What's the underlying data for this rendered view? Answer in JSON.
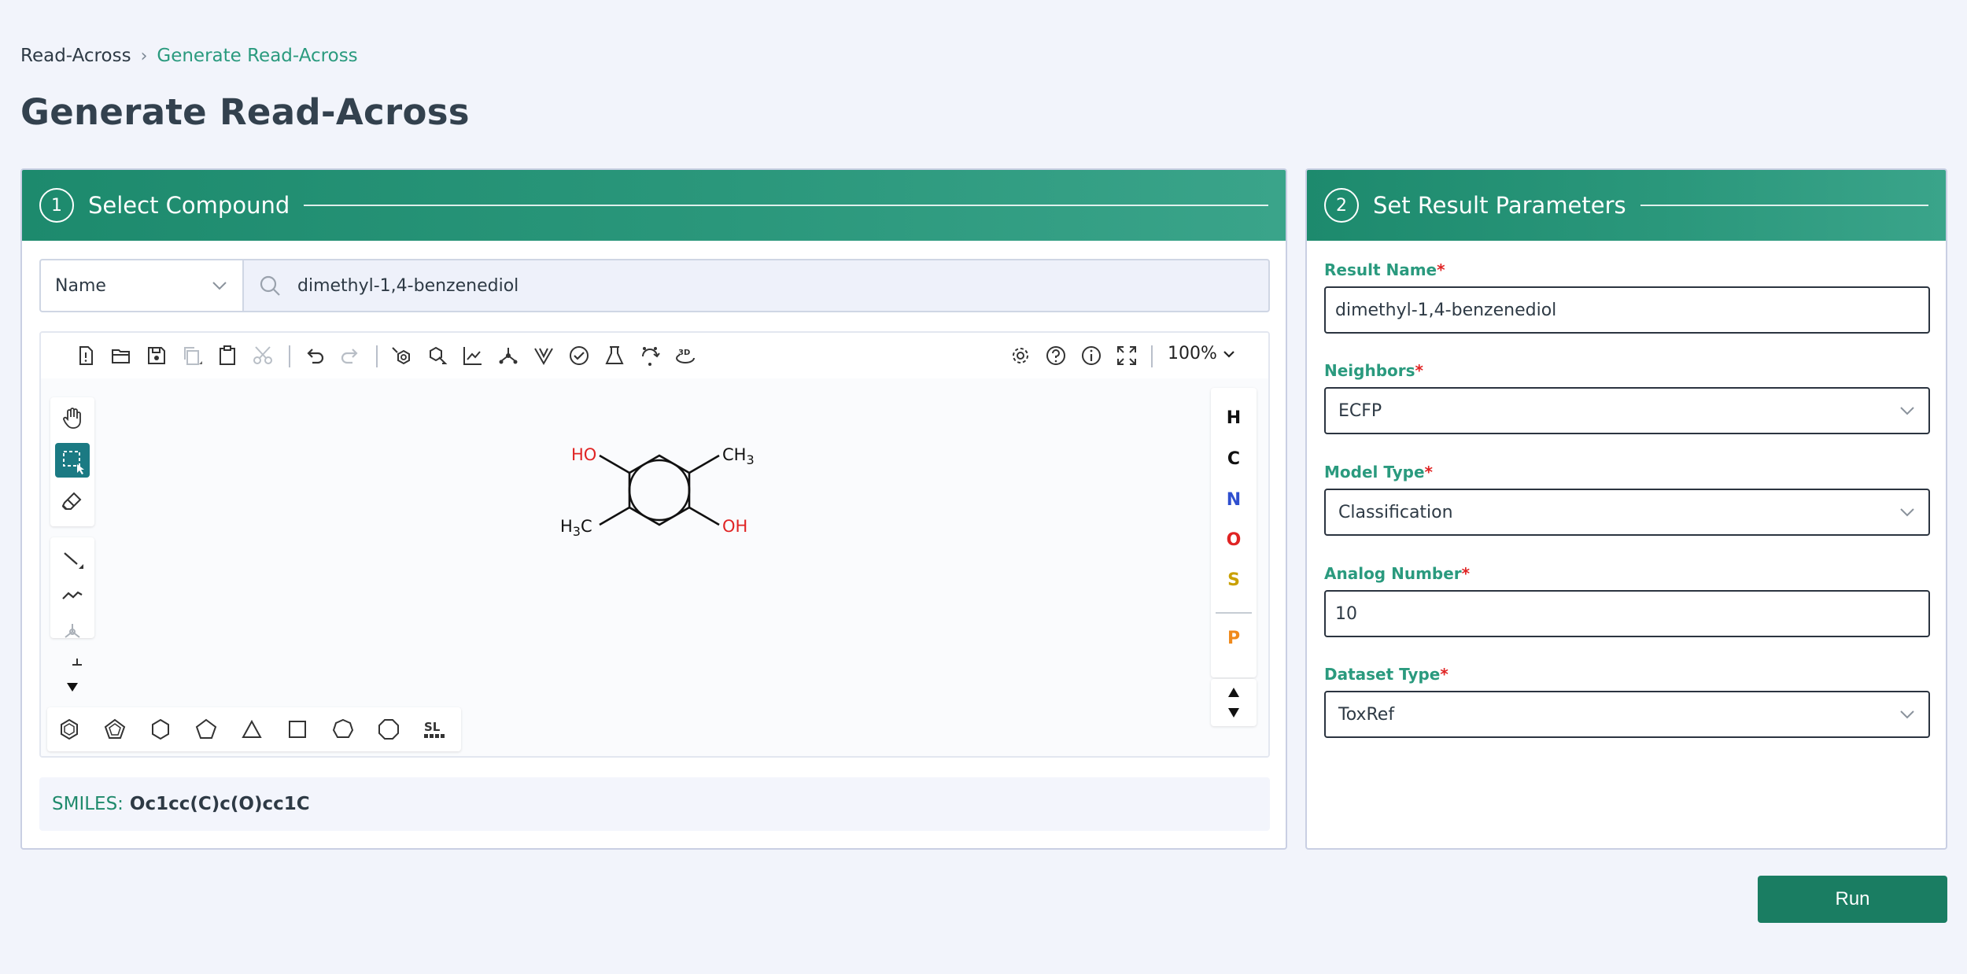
{
  "breadcrumb": {
    "root": "Read-Across",
    "separator": "›",
    "current": "Generate Read-Across"
  },
  "page_title": "Generate Read-Across",
  "panel1": {
    "step": "1",
    "title": "Select Compound",
    "search_type": "Name",
    "search_value": "dimethyl-1,4-benzenediol",
    "toolbar_zoom": "100%",
    "atoms": [
      "H",
      "C",
      "N",
      "O",
      "S",
      "P"
    ],
    "molecule": {
      "ho": "HO",
      "oh": "OH",
      "ch3": "CH",
      "ch3_sub": "3",
      "h3c_h": "H",
      "h3c_sub": "3",
      "h3c_c": "C"
    },
    "smiles_label": "SMILES:",
    "smiles_value": "Oc1cc(C)c(O)cc1C"
  },
  "panel2": {
    "step": "2",
    "title": "Set Result Parameters",
    "result_name_label": "Result Name",
    "result_name_value": "dimethyl-1,4-benzenediol",
    "neighbors_label": "Neighbors",
    "neighbors_value": "ECFP",
    "model_type_label": "Model Type",
    "model_type_value": "Classification",
    "analog_number_label": "Analog Number",
    "analog_number_value": "10",
    "dataset_type_label": "Dataset Type",
    "dataset_type_value": "ToxRef",
    "required_mark": "*"
  },
  "run_label": "Run",
  "colors": {
    "accent": "#1a7d62",
    "header": "#1d8a6d",
    "atom_N": "#2f4fcf",
    "atom_O": "#e02424",
    "atom_S": "#c9a000",
    "atom_P": "#f08a1c"
  }
}
